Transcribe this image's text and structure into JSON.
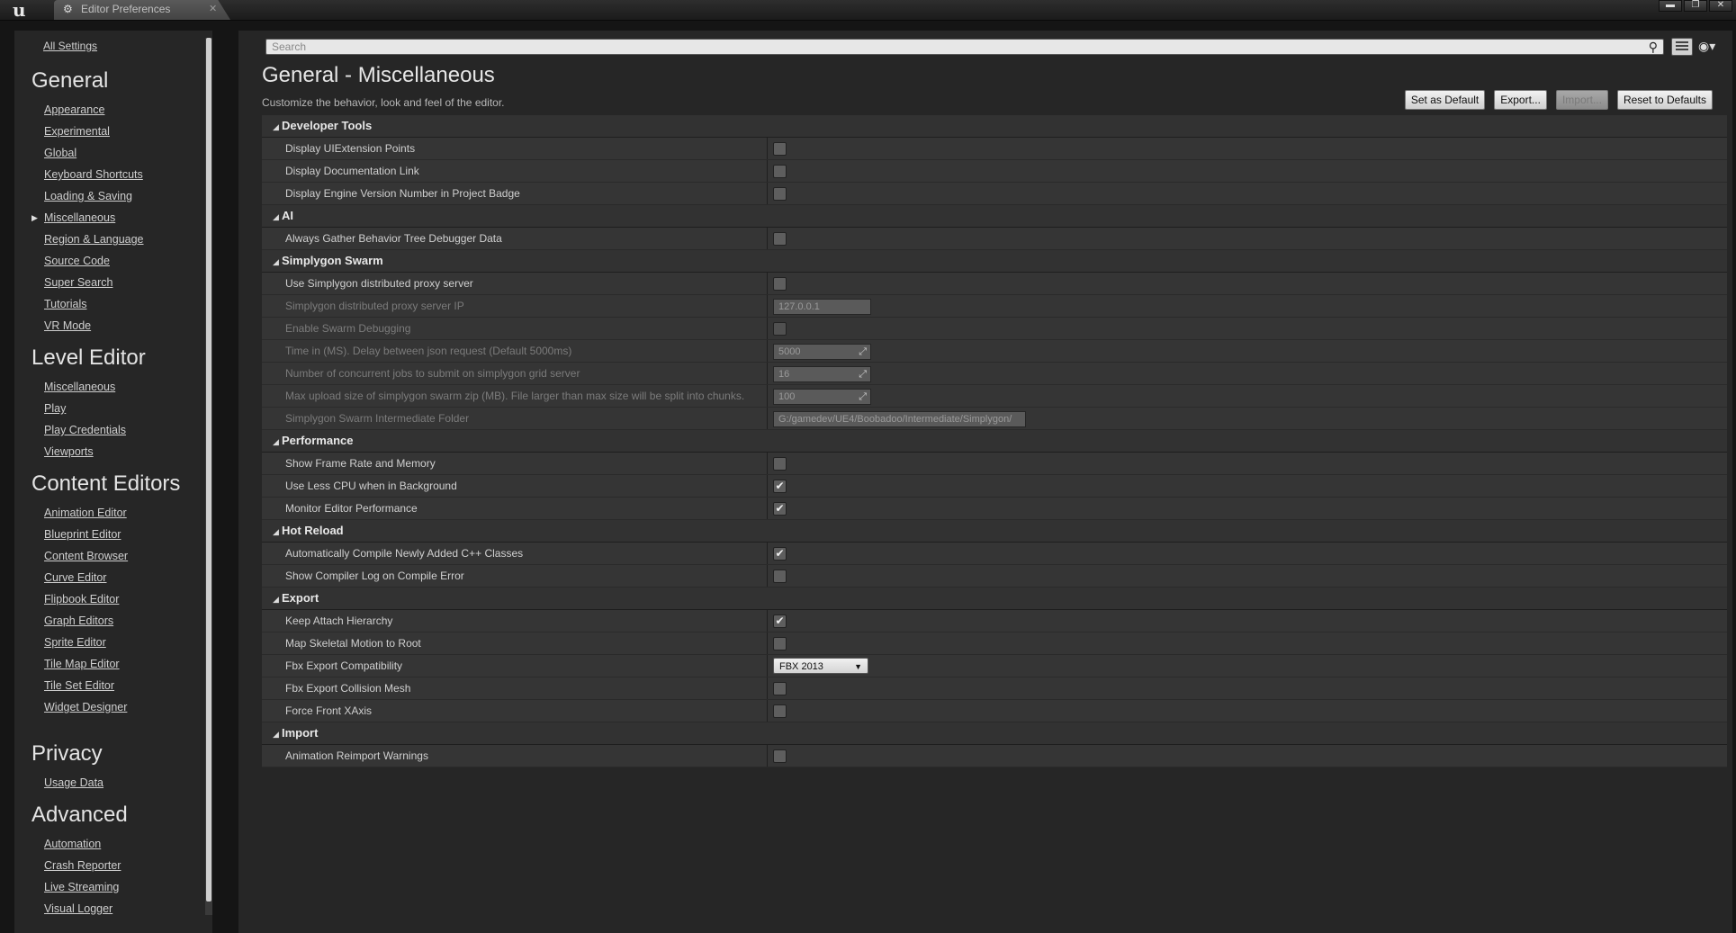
{
  "window": {
    "tab_title": "Editor Preferences",
    "logo_text": "u",
    "tab_icon": "gear-icon",
    "close_glyph": "✕",
    "controls": {
      "minimize": "▬",
      "maximize": "❐",
      "close": "✕"
    }
  },
  "sidebar": {
    "all_settings": "All Settings",
    "groups": [
      {
        "title": "General",
        "items": [
          "Appearance",
          "Experimental",
          "Global",
          "Keyboard Shortcuts",
          "Loading & Saving",
          "Miscellaneous",
          "Region & Language",
          "Source Code",
          "Super Search",
          "Tutorials",
          "VR Mode"
        ],
        "selected_index": 5
      },
      {
        "title": "Level Editor",
        "items": [
          "Miscellaneous",
          "Play",
          "Play Credentials",
          "Viewports"
        ]
      },
      {
        "title": "Content Editors",
        "items": [
          "Animation Editor",
          "Blueprint Editor",
          "Content Browser",
          "Curve Editor",
          "Flipbook Editor",
          "Graph Editors",
          "Sprite Editor",
          "Tile Map Editor",
          "Tile Set Editor",
          "Widget Designer"
        ]
      },
      {
        "title": "Privacy",
        "items": [
          "Usage Data"
        ]
      },
      {
        "title": "Advanced",
        "items": [
          "Automation",
          "Crash Reporter",
          "Live Streaming",
          "Visual Logger"
        ]
      }
    ]
  },
  "search": {
    "placeholder": "Search"
  },
  "page": {
    "title": "General - Miscellaneous",
    "description": "Customize the behavior, look and feel of the editor."
  },
  "actions": {
    "set_default": "Set as Default",
    "export": "Export...",
    "import": "Import...",
    "reset": "Reset to Defaults"
  },
  "sections": {
    "developer_tools": {
      "title": "Developer Tools",
      "rows": [
        {
          "label": "Display UIExtension Points",
          "checked": false
        },
        {
          "label": "Display Documentation Link",
          "checked": false
        },
        {
          "label": "Display Engine Version Number in Project Badge",
          "checked": false
        }
      ]
    },
    "ai": {
      "title": "AI",
      "rows": [
        {
          "label": "Always Gather Behavior Tree Debugger Data",
          "checked": false
        }
      ]
    },
    "simplygon": {
      "title": "Simplygon Swarm",
      "rows": {
        "use_proxy": {
          "label": "Use Simplygon distributed proxy server",
          "checked": false
        },
        "proxy_ip": {
          "label": "Simplygon distributed proxy server IP",
          "value": "127.0.0.1"
        },
        "swarm_debug": {
          "label": "Enable Swarm Debugging",
          "checked": false
        },
        "time_ms": {
          "label": "Time in (MS). Delay between json request (Default 5000ms)",
          "value": "5000"
        },
        "concurrent_jobs": {
          "label": "Number of concurrent jobs to submit on simplygon grid server",
          "value": "16"
        },
        "max_upload": {
          "label": "Max upload size of simplygon swarm zip (MB). File larger than max size will be split into chunks.",
          "value": "100"
        },
        "intermediate_folder": {
          "label": "Simplygon Swarm Intermediate Folder",
          "value": "G:/gamedev/UE4/Boobadoo/Intermediate/Simplygon/"
        }
      }
    },
    "performance": {
      "title": "Performance",
      "rows": [
        {
          "label": "Show Frame Rate and Memory",
          "checked": false
        },
        {
          "label": "Use Less CPU when in Background",
          "checked": true
        },
        {
          "label": "Monitor Editor Performance",
          "checked": true
        }
      ]
    },
    "hot_reload": {
      "title": "Hot Reload",
      "rows": [
        {
          "label": "Automatically Compile Newly Added C++ Classes",
          "checked": true
        },
        {
          "label": "Show Compiler Log on Compile Error",
          "checked": false
        }
      ]
    },
    "export": {
      "title": "Export",
      "rows": {
        "keep_attach": {
          "label": "Keep Attach Hierarchy",
          "checked": true
        },
        "map_skeletal": {
          "label": "Map Skeletal Motion to Root",
          "checked": false
        },
        "fbx_compat": {
          "label": "Fbx Export Compatibility",
          "value": "FBX 2013"
        },
        "fbx_collision": {
          "label": "Fbx Export Collision Mesh",
          "checked": false
        },
        "force_front": {
          "label": "Force Front XAxis",
          "checked": false
        }
      }
    },
    "import": {
      "title": "Import",
      "rows": [
        {
          "label": "Animation Reimport Warnings",
          "checked": false
        }
      ]
    }
  }
}
